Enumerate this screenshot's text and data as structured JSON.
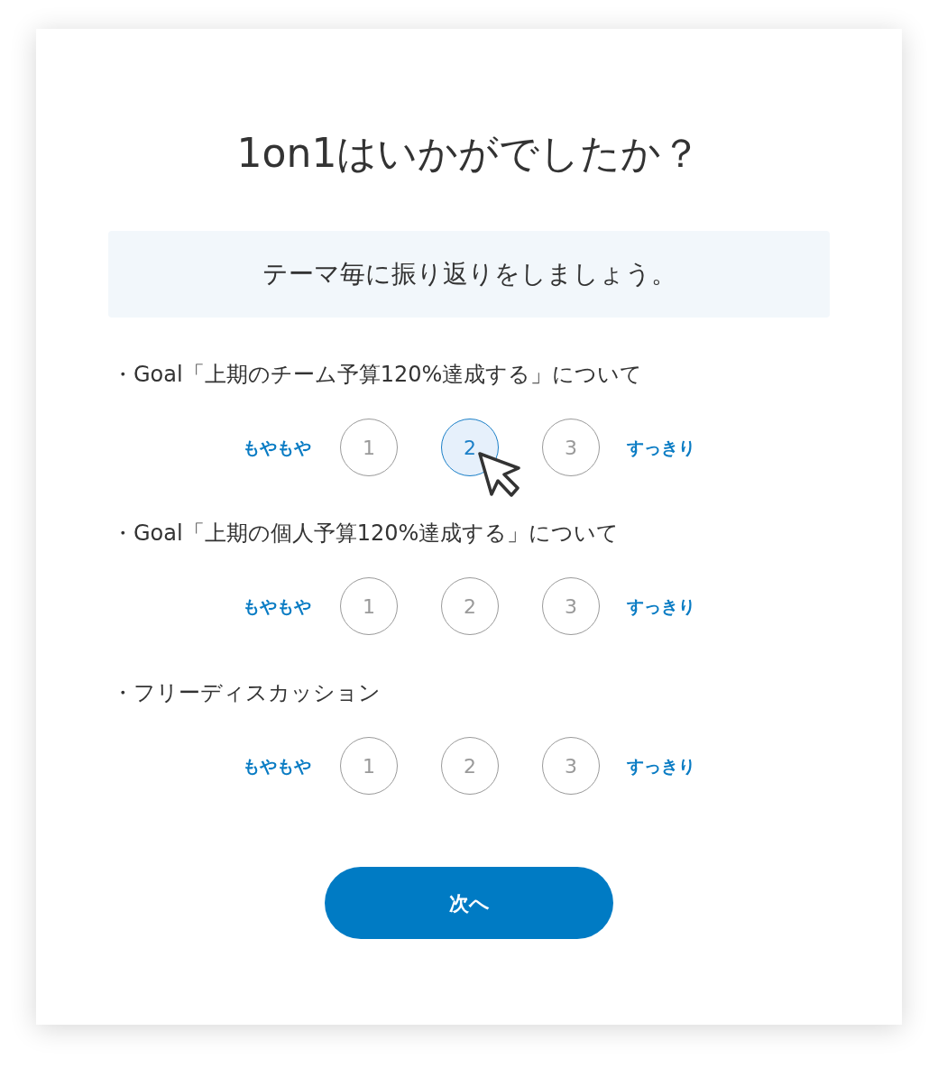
{
  "title": "1on1はいかがでしたか？",
  "banner": "テーマ毎に振り返りをしましょう。",
  "themes": [
    {
      "label": "・Goal「上期のチーム予算120%達成する」について",
      "low_label": "もやもや",
      "high_label": "すっきり",
      "options": [
        {
          "label": "1",
          "selected": false
        },
        {
          "label": "2",
          "selected": true
        },
        {
          "label": "3",
          "selected": false
        }
      ]
    },
    {
      "label": "・Goal「上期の個人予算120%達成する」について",
      "low_label": "もやもや",
      "high_label": "すっきり",
      "options": [
        {
          "label": "1",
          "selected": false
        },
        {
          "label": "2",
          "selected": false
        },
        {
          "label": "3",
          "selected": false
        }
      ]
    },
    {
      "label": "・フリーディスカッション",
      "low_label": "もやもや",
      "high_label": "すっきり",
      "options": [
        {
          "label": "1",
          "selected": false
        },
        {
          "label": "2",
          "selected": false
        },
        {
          "label": "3",
          "selected": false
        }
      ]
    }
  ],
  "next_button": "次へ"
}
